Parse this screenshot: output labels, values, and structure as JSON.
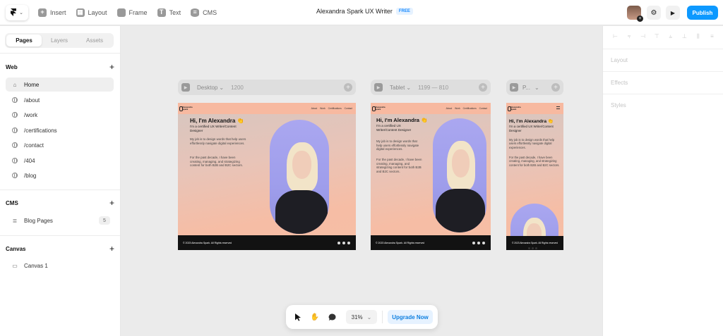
{
  "toolbar": {
    "tools": [
      {
        "label": "Insert",
        "icon": "plus-icon"
      },
      {
        "label": "Layout",
        "icon": "layout-icon"
      },
      {
        "label": "Frame",
        "icon": "frame-icon"
      },
      {
        "label": "Text",
        "icon": "text-icon"
      },
      {
        "label": "CMS",
        "icon": "database-icon"
      }
    ],
    "project_title": "Alexandra Spark UX Writer",
    "plan_badge": "FREE",
    "publish_label": "Publish"
  },
  "sidebar": {
    "tabs": [
      "Pages",
      "Layers",
      "Assets"
    ],
    "active_tab": "Pages",
    "sections": {
      "web": {
        "title": "Web",
        "pages": [
          "Home",
          "/about",
          "/work",
          "/certifications",
          "/contact",
          "/404",
          "/blog"
        ]
      },
      "cms": {
        "title": "CMS",
        "items": [
          {
            "label": "Blog Pages",
            "count": "5"
          }
        ]
      },
      "canvas": {
        "title": "Canvas",
        "items": [
          "Canvas 1"
        ]
      }
    }
  },
  "right_panel": {
    "sections": [
      "Layout",
      "Effects",
      "Styles"
    ]
  },
  "breakpoints": {
    "desktop": {
      "label": "Desktop",
      "size": "1200"
    },
    "tablet": {
      "label": "Tablet",
      "size": "1199 — 810"
    },
    "phone": {
      "label": "P..."
    }
  },
  "site": {
    "brand": "Alexandra Spark",
    "nav_links": "About Work Certifications Contact",
    "headline": "Hi, I'm Alexandra 👏",
    "subtitle": "I'm a certified UX Writer/Content Designer",
    "para1": "My job is to design words that help users effortlessly navigate digital experiences.",
    "para2": "For the past decade, I have been creating, managing, and strategizing content for both B2B and B2C sectors.",
    "footer": "© 2023 Alexandra Spark. All Rights reserved"
  },
  "bottombar": {
    "zoom": "31%",
    "upgrade_label": "Upgrade Now"
  },
  "colors": {
    "accent": "#0d99ff",
    "site_peach": "#f7b9a0",
    "photo_lavender": "#9e9deb"
  }
}
